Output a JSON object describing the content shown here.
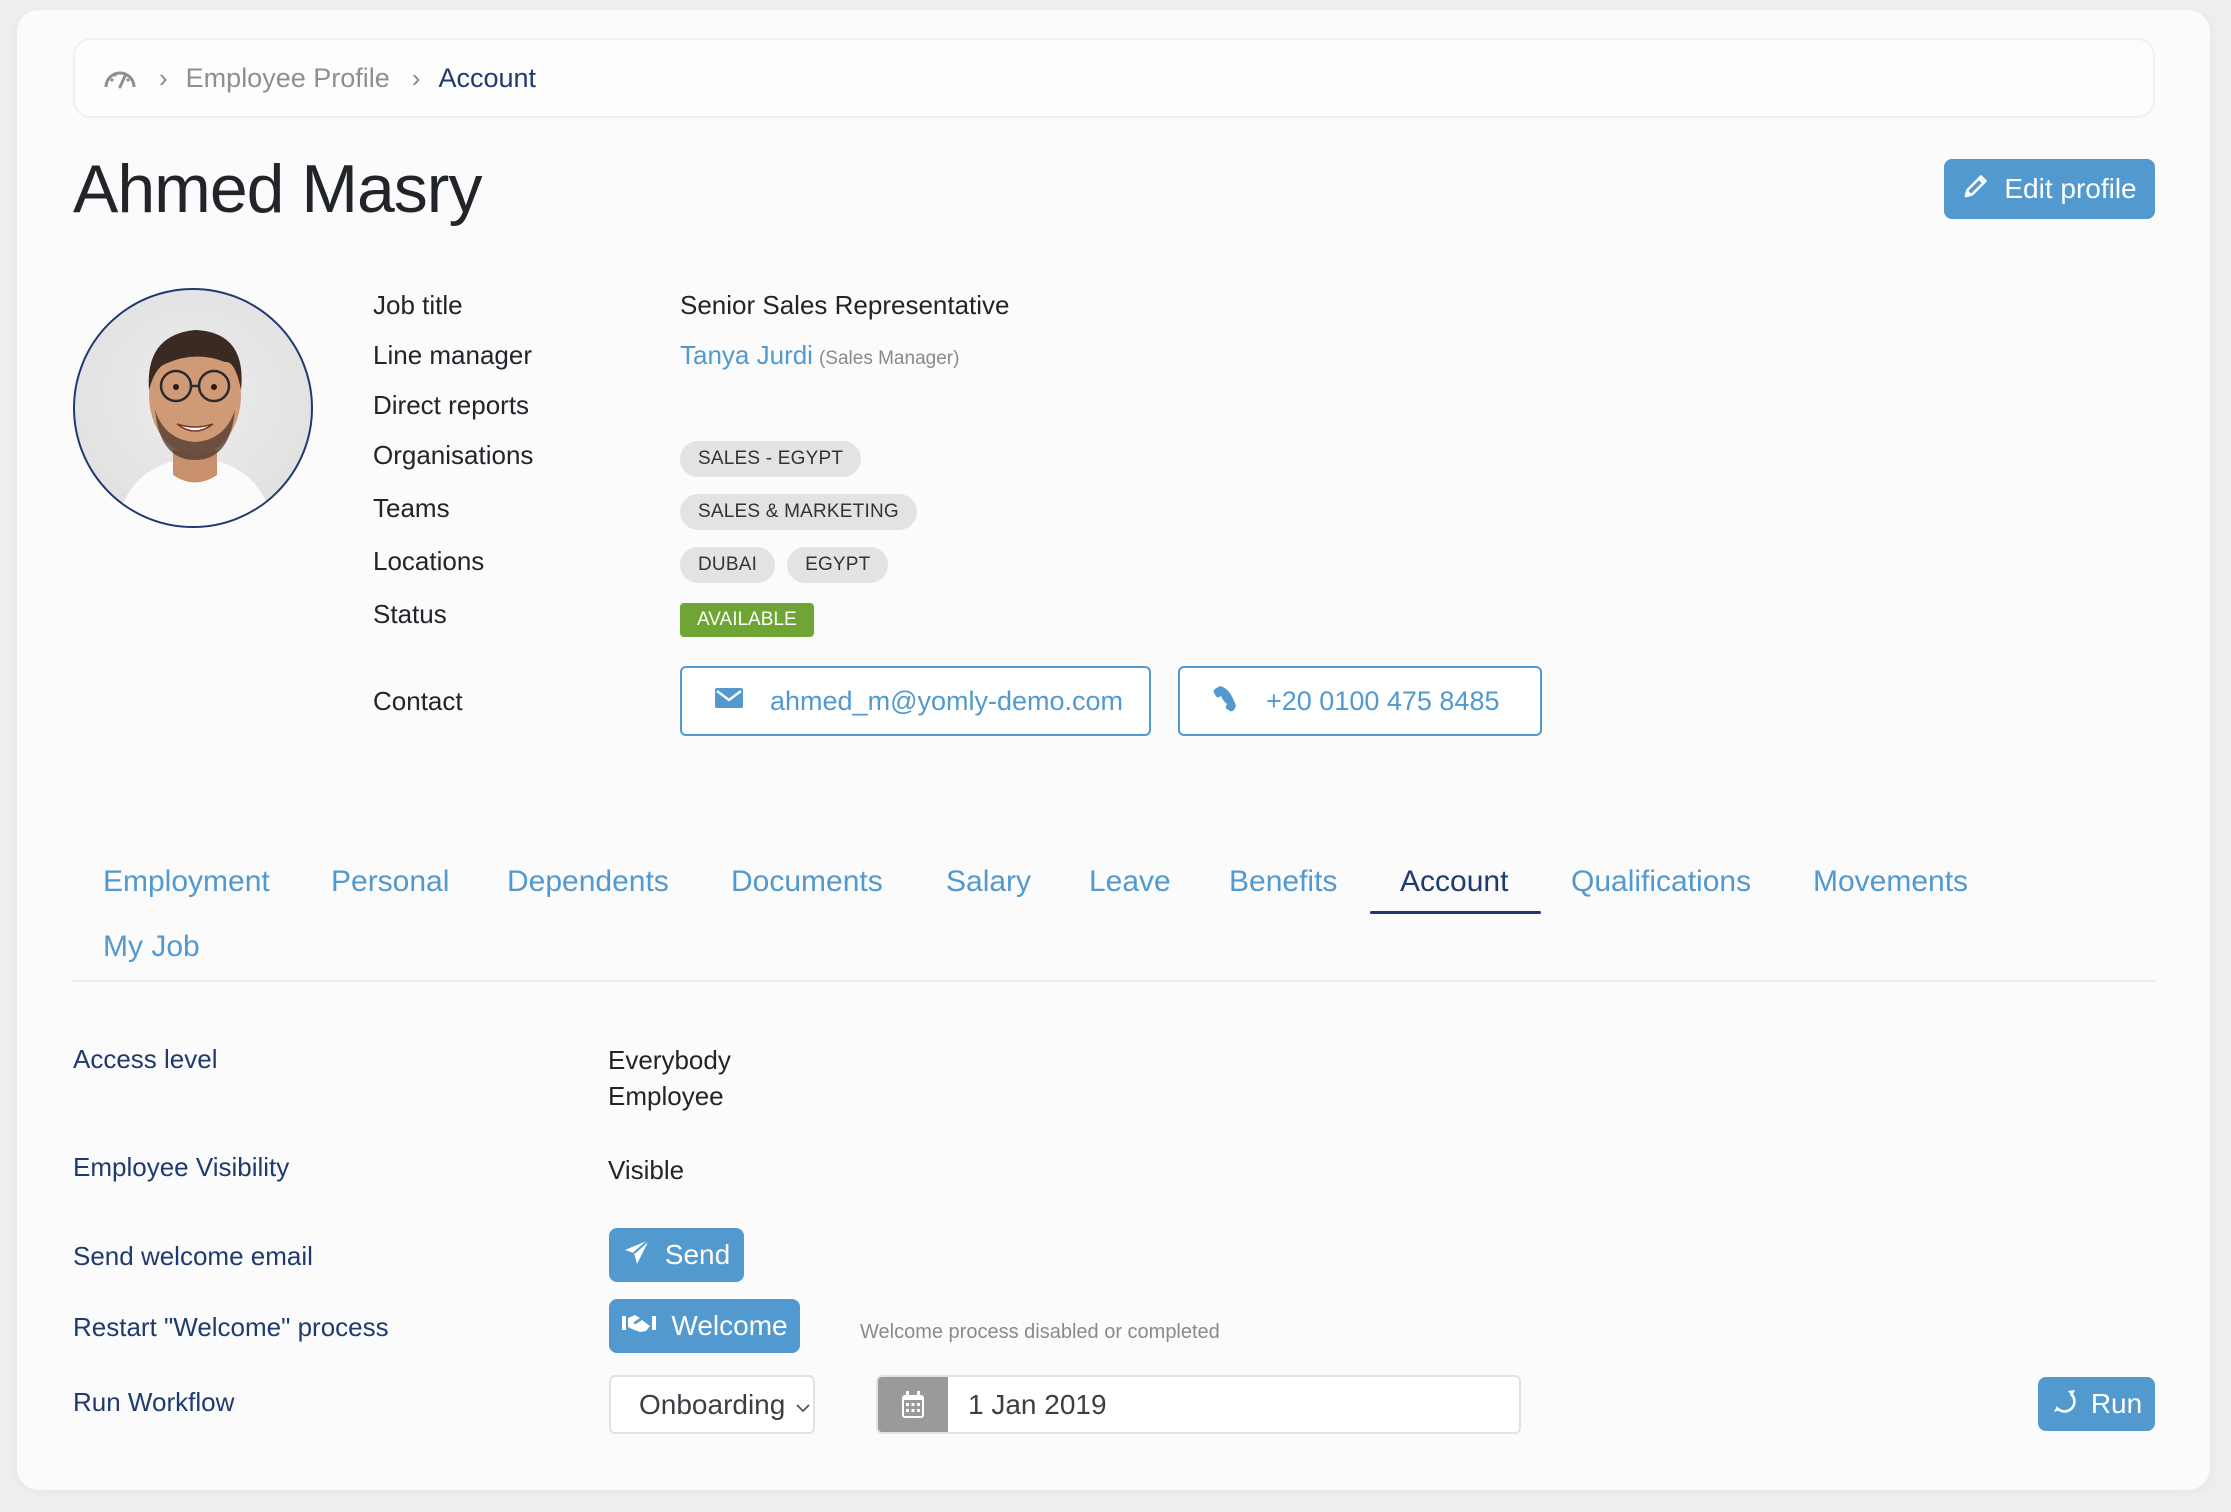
{
  "breadcrumb": {
    "home_icon": "dashboard-gauge-icon",
    "items": [
      "Employee Profile",
      "Account"
    ],
    "separator_icon": "chevron-right-icon"
  },
  "header": {
    "title": "Ahmed Masry",
    "edit_button": {
      "label": "Edit profile",
      "icon": "pencil-icon"
    }
  },
  "profile": {
    "avatar_alt": "Employee photo",
    "fields": {
      "job_title": {
        "label": "Job title",
        "value": "Senior Sales Representative"
      },
      "line_manager": {
        "label": "Line manager",
        "name": "Tanya Jurdi",
        "role": "(Sales Manager)"
      },
      "direct_reports": {
        "label": "Direct reports",
        "value": ""
      },
      "organisations": {
        "label": "Organisations",
        "chips": [
          "SALES - EGYPT"
        ]
      },
      "teams": {
        "label": "Teams",
        "chips": [
          "SALES & MARKETING"
        ]
      },
      "locations": {
        "label": "Locations",
        "chips": [
          "DUBAI",
          "EGYPT"
        ]
      },
      "status": {
        "label": "Status",
        "value": "AVAILABLE",
        "color": "#6ea535"
      },
      "contact": {
        "label": "Contact",
        "email": "ahmed_m@yomly-demo.com",
        "email_icon": "envelope-icon",
        "phone": "+20 0100 475 8485",
        "phone_icon": "phone-icon"
      }
    }
  },
  "tabs": [
    {
      "label": "Employment",
      "active": false
    },
    {
      "label": "Personal",
      "active": false
    },
    {
      "label": "Dependents",
      "active": false
    },
    {
      "label": "Documents",
      "active": false
    },
    {
      "label": "Salary",
      "active": false
    },
    {
      "label": "Leave",
      "active": false
    },
    {
      "label": "Benefits",
      "active": false
    },
    {
      "label": "Account",
      "active": true
    },
    {
      "label": "Qualifications",
      "active": false
    },
    {
      "label": "Movements",
      "active": false
    },
    {
      "label": "My Job",
      "active": false
    }
  ],
  "account": {
    "access_level": {
      "label": "Access level",
      "values": [
        "Everybody",
        "Employee"
      ]
    },
    "visibility": {
      "label": "Employee Visibility",
      "value": "Visible"
    },
    "welcome_email": {
      "label": "Send welcome email",
      "button": "Send",
      "icon": "paper-plane-icon"
    },
    "welcome_process": {
      "label": "Restart \"Welcome\" process",
      "button": "Welcome",
      "icon": "handshake-icon",
      "helper": "Welcome process disabled or completed"
    },
    "workflow": {
      "label": "Run Workflow",
      "selected": "Onboarding",
      "date": "1 Jan 2019",
      "date_icon": "calendar-icon",
      "run_button": "Run",
      "run_icon": "refresh-icon"
    }
  },
  "colors": {
    "accent": "#5199cf",
    "navy": "#1f3a6e",
    "status_available": "#6ea535",
    "chip_bg": "#e3e3e3"
  }
}
